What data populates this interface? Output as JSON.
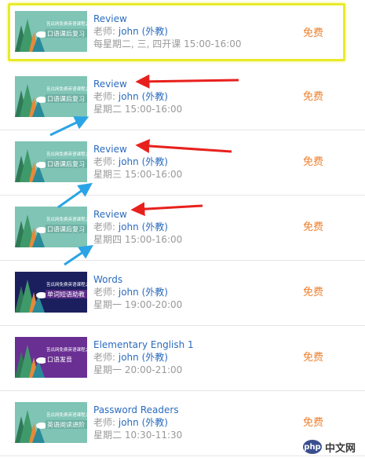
{
  "courses": [
    {
      "title": "Review",
      "teacher_label": "老师:",
      "teacher": "john (外教)",
      "schedule": "每星期二, 三, 四开课  15:00-16:00",
      "price": "免费",
      "thumb": {
        "bg": "#7fc4b5",
        "banner": "#6db0a3",
        "text": "口语课后复习",
        "top_text": "苦瓜网免费英语课程之"
      }
    },
    {
      "title": "Review",
      "teacher_label": "老师:",
      "teacher": "john (外教)",
      "schedule": "星期二  15:00-16:00",
      "price": "免费",
      "thumb": {
        "bg": "#7fc4b5",
        "banner": "#6db0a3",
        "text": "口语课后复习",
        "top_text": "苦瓜网免费英语课程之"
      }
    },
    {
      "title": "Review",
      "teacher_label": "老师:",
      "teacher": "john (外教)",
      "schedule": "星期三  15:00-16:00",
      "price": "免费",
      "thumb": {
        "bg": "#7fc4b5",
        "banner": "#6db0a3",
        "text": "口语课后复习",
        "top_text": "苦瓜网免费英语课程之"
      }
    },
    {
      "title": "Review",
      "teacher_label": "老师:",
      "teacher": "john (外教)",
      "schedule": "星期四  15:00-16:00",
      "price": "免费",
      "thumb": {
        "bg": "#7fc4b5",
        "banner": "#6db0a3",
        "text": "口语课后复习",
        "top_text": "苦瓜网免费英语课程之"
      }
    },
    {
      "title": "Words",
      "teacher_label": "老师:",
      "teacher": "john (外教)",
      "schedule": "星期一  19:00-20:00",
      "price": "免费",
      "thumb": {
        "bg": "#1c1f5e",
        "banner": "#5a2a86",
        "text": "单词短语助教",
        "top_text": "苦瓜网免费英语课程之"
      }
    },
    {
      "title": "Elementary English 1",
      "teacher_label": "老师:",
      "teacher": "john (外教)",
      "schedule": "星期一  20:00-21:00",
      "price": "免费",
      "thumb": {
        "bg": "#6a2f93",
        "banner": "#6a2f93",
        "text": "口语发音",
        "top_text": "苦瓜网免费英语课程之"
      }
    },
    {
      "title": "Password Readers",
      "teacher_label": "老师:",
      "teacher": "john (外教)",
      "schedule": "星期二  10:30-11:30",
      "price": "免费",
      "thumb": {
        "bg": "#7fc4b5",
        "banner": "#6db0a3",
        "text": "英语阅读进阶",
        "top_text": "苦瓜网免费英语课程之"
      }
    }
  ],
  "watermark": {
    "logo": "php",
    "site": "中文网"
  },
  "colors": {
    "highlight_border": "#e9ea2a",
    "arrow_red": "#e8201c",
    "arrow_blue": "#2aa4e6"
  }
}
